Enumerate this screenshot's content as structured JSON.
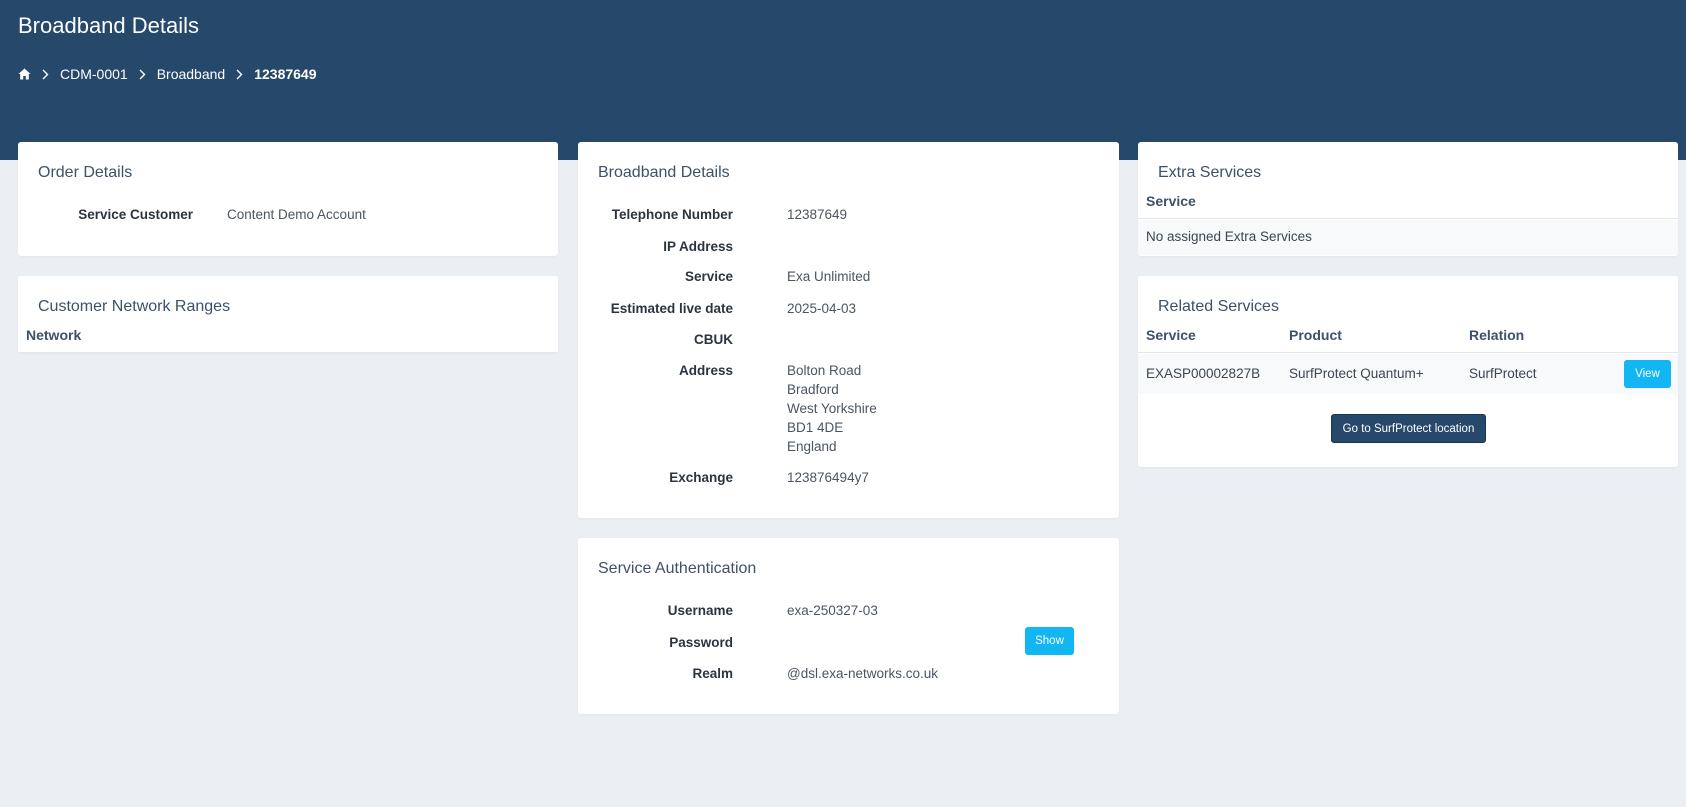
{
  "page": {
    "title": "Broadband Details",
    "breadcrumb": [
      "CDM-0001",
      "Broadband",
      "12387649"
    ]
  },
  "order_details": {
    "title": "Order Details",
    "rows": [
      {
        "label": "Service Customer",
        "value": "Content Demo Account"
      }
    ]
  },
  "network_ranges": {
    "title": "Customer Network Ranges",
    "column": "Network"
  },
  "broadband_details": {
    "title": "Broadband Details",
    "telephone_label": "Telephone Number",
    "telephone_value": "12387649",
    "ip_label": "IP Address",
    "ip_value": "",
    "service_label": "Service",
    "service_value": "Exa Unlimited",
    "live_date_label": "Estimated live date",
    "live_date_value": "2025-04-03",
    "cbuk_label": "CBUK",
    "cbuk_value": "",
    "address_label": "Address",
    "address_lines": [
      "Bolton Road",
      "Bradford",
      "West Yorkshire",
      "BD1 4DE",
      "England"
    ],
    "exchange_label": "Exchange",
    "exchange_value": "123876494y7"
  },
  "service_auth": {
    "title": "Service Authentication",
    "username_label": "Username",
    "username_value": "exa-250327-03",
    "password_label": "Password",
    "password_value": "",
    "show_button": "Show",
    "realm_label": "Realm",
    "realm_value": "@dsl.exa-networks.co.uk"
  },
  "extra_services": {
    "title": "Extra Services",
    "column": "Service",
    "empty_text": "No assigned Extra Services"
  },
  "related_services": {
    "title": "Related Services",
    "columns": [
      "Service",
      "Product",
      "Relation"
    ],
    "rows": [
      {
        "service": "EXASP00002827B",
        "product": "SurfProtect Quantum+",
        "relation": "SurfProtect",
        "action": "View"
      }
    ],
    "goto_button": "Go to SurfProtect location"
  },
  "colors": {
    "header_bg": "#26486b",
    "page_bg": "#ebeff4",
    "accent_button": "#12b6f3"
  },
  "icons": {
    "home": "home-icon",
    "separator": "chevron-right-icon"
  }
}
